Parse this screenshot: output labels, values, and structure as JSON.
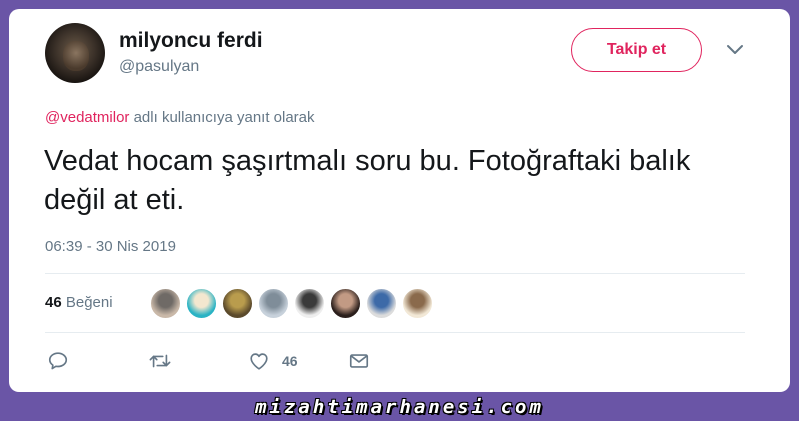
{
  "tweet": {
    "author": {
      "display_name": "milyoncu ferdi",
      "handle": "@pasulyan"
    },
    "follow_label": "Takip et",
    "reply_to": {
      "mention": "@vedatmilor",
      "suffix": " adlı kullanıcıya yanıt olarak"
    },
    "text": "Vedat hocam şaşırtmalı soru bu. Fotoğraftaki balık değil at eti.",
    "timestamp": "06:39 - 30 Nis 2019",
    "likes": {
      "count": "46",
      "label": "Beğeni"
    },
    "likers": [
      {
        "name": "liker-avatar-1",
        "colors": [
          "#c9b8a8",
          "#6f6a66"
        ]
      },
      {
        "name": "liker-avatar-2",
        "colors": [
          "#2ab3c4",
          "#f3e7cf"
        ]
      },
      {
        "name": "liker-avatar-3",
        "colors": [
          "#5b4a2c",
          "#b99c4d"
        ]
      },
      {
        "name": "liker-avatar-4",
        "colors": [
          "#c7d1db",
          "#7f8d99"
        ]
      },
      {
        "name": "liker-avatar-5",
        "colors": [
          "#eeeeee",
          "#3a3a3a"
        ]
      },
      {
        "name": "liker-avatar-6",
        "colors": [
          "#2b1f1c",
          "#c29a84"
        ]
      },
      {
        "name": "liker-avatar-7",
        "colors": [
          "#dcdcdc",
          "#3d6aa8"
        ]
      },
      {
        "name": "liker-avatar-8",
        "colors": [
          "#f2e8d6",
          "#8a6a4c"
        ]
      }
    ],
    "actions": {
      "reply_icon": "speech-bubble-icon",
      "retweet_icon": "retweet-icon",
      "like_icon": "heart-icon",
      "like_count": "46",
      "message_icon": "envelope-icon"
    }
  },
  "watermark": "mizahtimarhanesi.com",
  "colors": {
    "background": "#6a55a6",
    "accent": "#e0245e",
    "secondary_text": "#657786"
  }
}
